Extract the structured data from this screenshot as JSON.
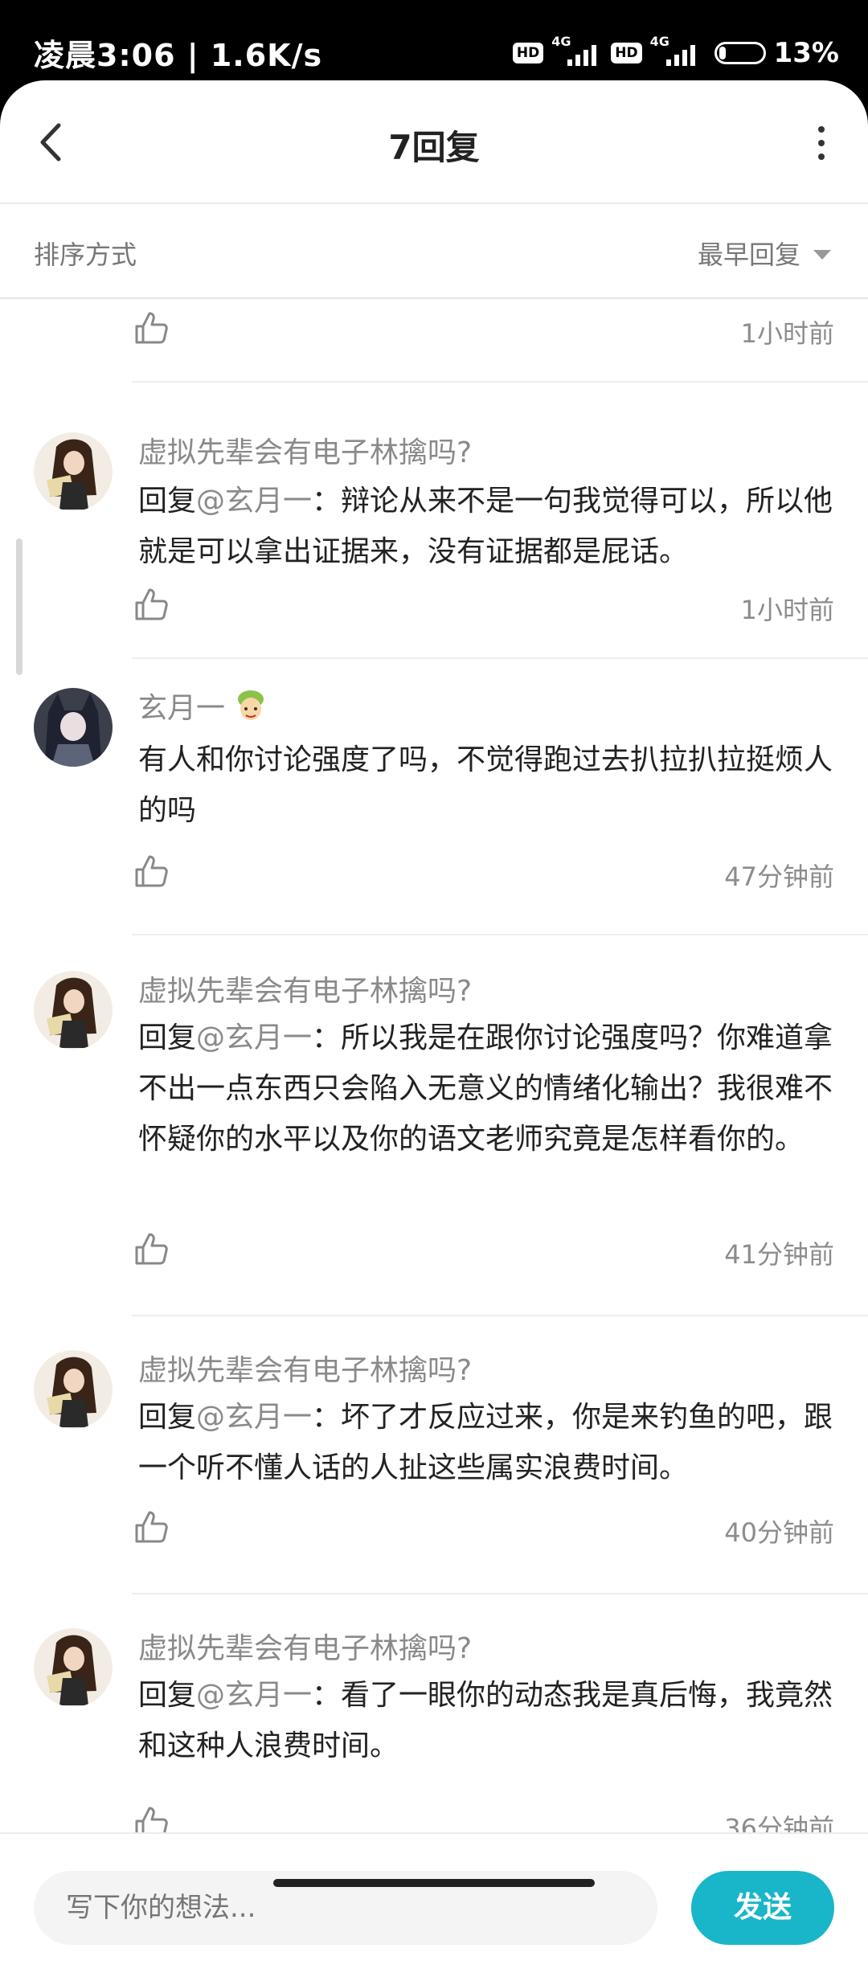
{
  "status_bar": {
    "time": "凌晨3:06 | 1.6K/s",
    "hd": "HD",
    "network": "4G",
    "battery": "13%",
    "battery_level_percent": 13
  },
  "header": {
    "title": "7回复"
  },
  "sort": {
    "label": "排序方式",
    "value": "最早回复"
  },
  "top_row": {
    "time": "1小时前"
  },
  "comments": [
    {
      "username": "虚拟先辈会有电子林擒吗?",
      "reply_prefix": "回复",
      "mention": "@玄月一",
      "text": "：辩论从来不是一句我觉得可以，所以他就是可以拿出证据来，没有证据都是屁话。",
      "time": "1小时前",
      "avatar": "anime-girl-avatar"
    },
    {
      "username": "玄月一",
      "reply_prefix": "",
      "mention": "",
      "text": "有人和你讨论强度了吗，不觉得跑过去扒拉扒拉挺烦人的吗",
      "time": "47分钟前",
      "avatar": "dark-hair-avatar",
      "badge": "level-badge-icon"
    },
    {
      "username": "虚拟先辈会有电子林擒吗?",
      "reply_prefix": "回复",
      "mention": "@玄月一",
      "text": "：所以我是在跟你讨论强度吗？你难道拿不出一点东西只会陷入无意义的情绪化输出？我很难不怀疑你的水平以及你的语文老师究竟是怎样看你的。",
      "time": "41分钟前",
      "avatar": "anime-girl-avatar"
    },
    {
      "username": "虚拟先辈会有电子林擒吗?",
      "reply_prefix": "回复",
      "mention": "@玄月一",
      "text": "：坏了才反应过来，你是来钓鱼的吧，跟一个听不懂人话的人扯这些属实浪费时间。",
      "time": "40分钟前",
      "avatar": "anime-girl-avatar"
    },
    {
      "username": "虚拟先辈会有电子林擒吗?",
      "reply_prefix": "回复",
      "mention": "@玄月一",
      "text": "：看了一眼你的动态我是真后悔，我竟然和这种人浪费时间。",
      "time": "36分钟前",
      "avatar": "anime-girl-avatar"
    }
  ],
  "input": {
    "placeholder": "写下你的想法...",
    "send_label": "发送"
  },
  "colors": {
    "accent": "#19b5c8",
    "secondary_text": "#8a8a8a"
  }
}
